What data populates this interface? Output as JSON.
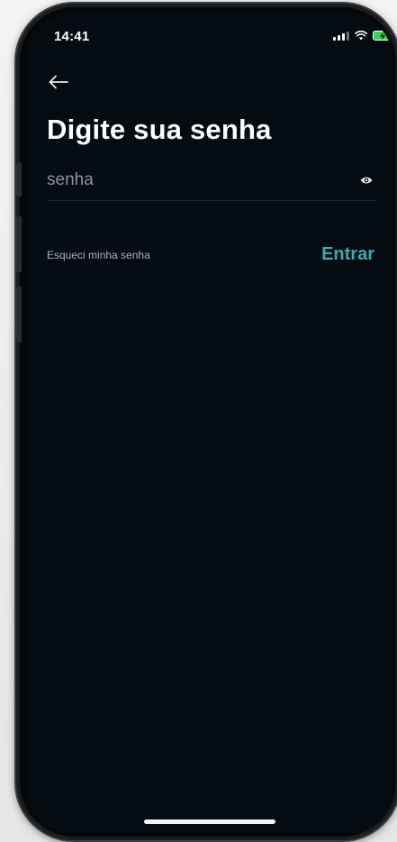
{
  "status_bar": {
    "time": "14:41"
  },
  "header": {
    "title": "Digite sua senha"
  },
  "password_field": {
    "placeholder": "senha",
    "value": ""
  },
  "actions": {
    "forgot_label": "Esqueci minha senha",
    "submit_label": "Entrar"
  },
  "icons": {
    "back": "back-arrow-icon",
    "visibility": "eye-icon",
    "signal": "signal-icon",
    "wifi": "wifi-icon",
    "battery": "battery-charging-icon"
  },
  "colors": {
    "background": "#050c11",
    "accent": "#3da9b3",
    "title": "#ffffff",
    "secondary_text": "#a9b2b8"
  }
}
